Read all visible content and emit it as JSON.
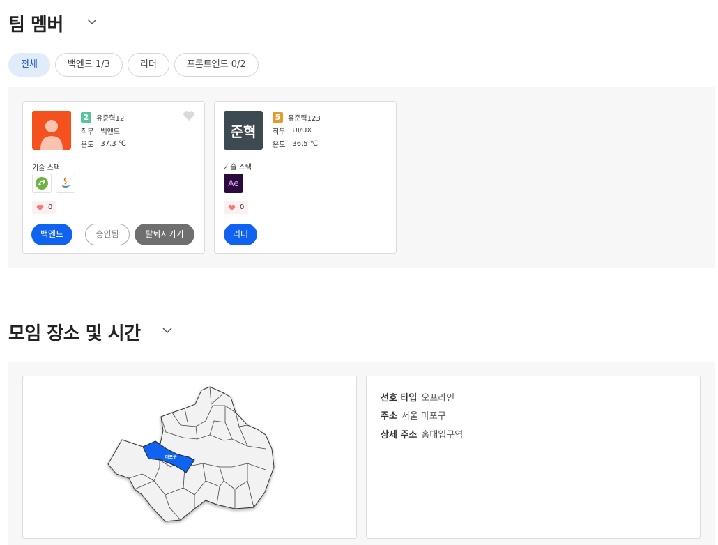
{
  "team": {
    "title": "팀 멤버",
    "tabs": [
      {
        "label": "전체",
        "active": true
      },
      {
        "label": "백엔드 1/3",
        "active": false
      },
      {
        "label": "리더",
        "active": false
      },
      {
        "label": "프론트엔드 0/2",
        "active": false
      }
    ],
    "labels": {
      "role": "직무",
      "temp": "온도",
      "skills": "기술 스택"
    },
    "members": [
      {
        "level": "2",
        "level_color": "#55c59a",
        "name": "유준혁12",
        "role": "백엔드",
        "temp": "37.3 ℃",
        "skills": [
          "spring-icon",
          "java-icon"
        ],
        "likes": "0",
        "position_label": "백엔드",
        "status_label": "승인됨",
        "kick_label": "탈퇴시키기"
      },
      {
        "level": "5",
        "level_color": "#e49a2d",
        "name": "유준혁123",
        "role": "UI/UX",
        "temp": "36.5 ℃",
        "avatar_text": "준혁",
        "skills": [
          "after-effects-icon"
        ],
        "skill_text": "Ae",
        "likes": "0",
        "position_label": "리더"
      }
    ]
  },
  "meeting": {
    "title": "모임 장소 및 시간",
    "map": {
      "selected_district": "마포구",
      "highlight_color": "#0f63f0"
    },
    "preferred_type_label": "선호 타입",
    "preferred_type": "오프라인",
    "address_label": "주소",
    "address": "서울 마포구",
    "detail_address_label": "상세 주소",
    "detail_address": "홍대입구역"
  },
  "colors": {
    "accent": "#0f63f0",
    "tab_active_bg": "#e1ecfb",
    "panel_bg": "#f7f7f7"
  }
}
